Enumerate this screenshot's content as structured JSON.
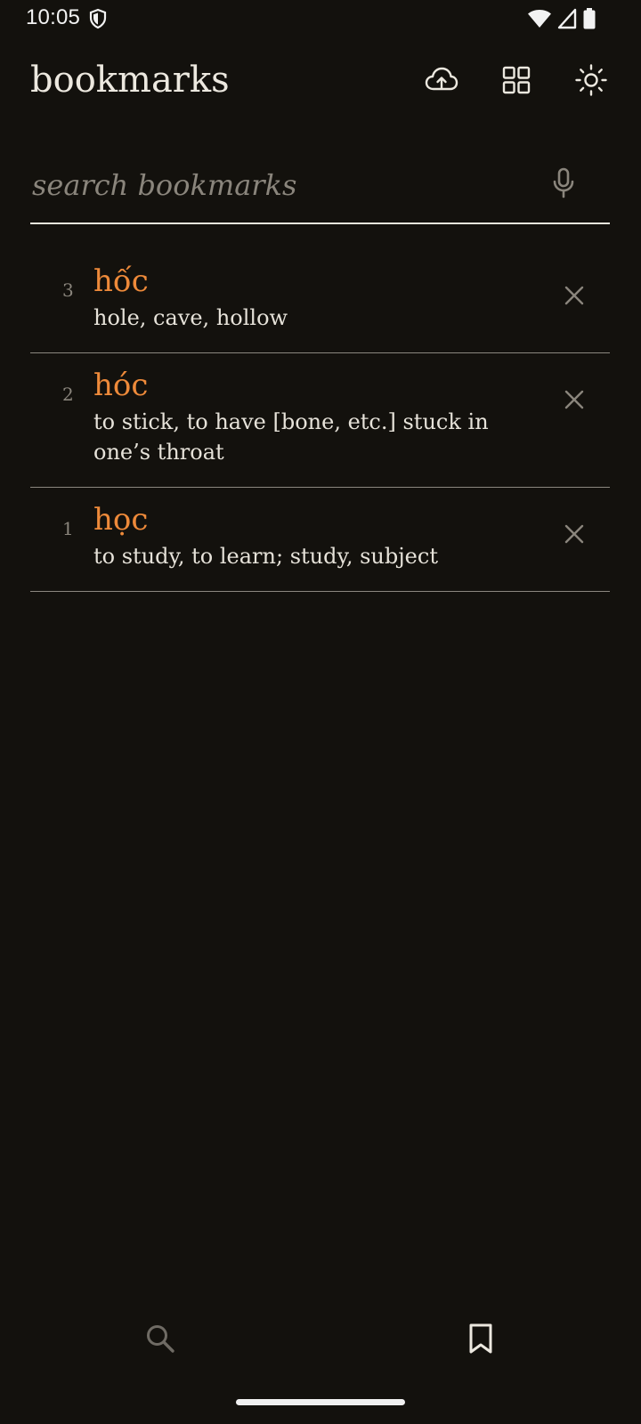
{
  "status_bar": {
    "time": "10:05",
    "icons": [
      "shield-icon",
      "wifi-icon",
      "cell-signal-icon",
      "battery-icon"
    ]
  },
  "header": {
    "title": "bookmarks",
    "actions": [
      "cloud-upload-icon",
      "grid-view-icon",
      "brightness-icon"
    ]
  },
  "search": {
    "placeholder": "search bookmarks",
    "value": ""
  },
  "bookmarks": [
    {
      "index": "3",
      "word": "hốc",
      "definition": "hole, cave, hollow"
    },
    {
      "index": "2",
      "word": "hóc",
      "definition": "to stick, to have [bone, etc.] stuck in one’s throat"
    },
    {
      "index": "1",
      "word": "học",
      "definition": "to study, to learn; study, subject"
    }
  ],
  "bottom_nav": {
    "items": [
      "search-icon",
      "bookmark-icon"
    ],
    "active": "bookmark-icon"
  },
  "colors": {
    "background": "#13110d",
    "accent": "#ee8a3a",
    "text": "#e9e5dc",
    "muted": "#8a857c"
  }
}
